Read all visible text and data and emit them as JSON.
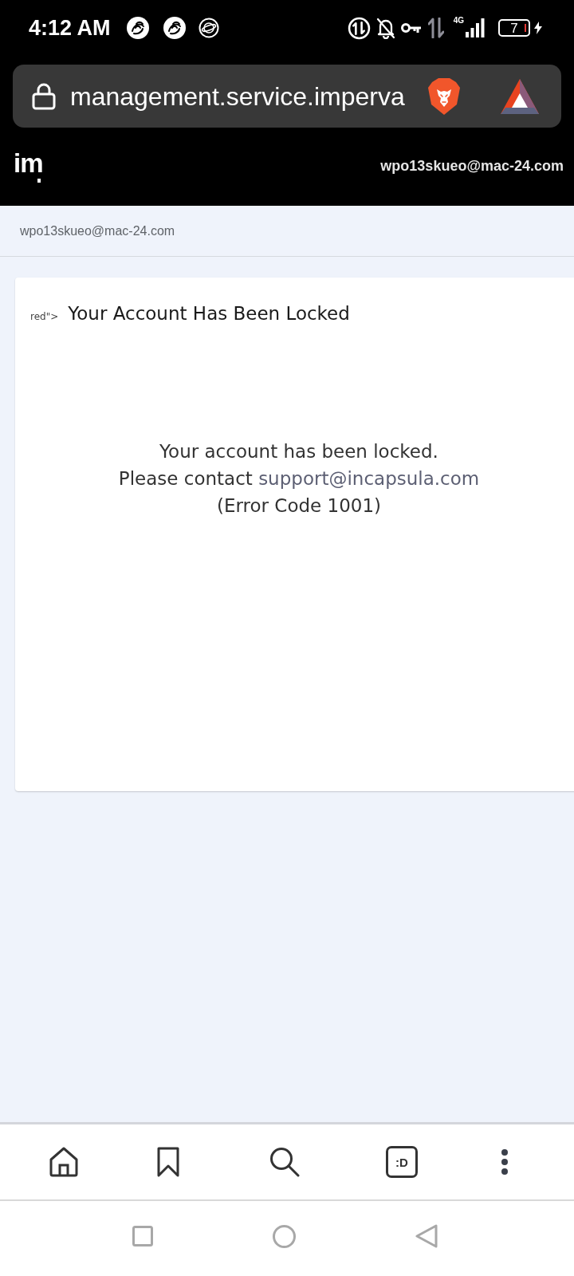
{
  "status_bar": {
    "time": "4:12 AM",
    "network_type": "4G",
    "battery": "7"
  },
  "browser": {
    "url": "management.service.imperva"
  },
  "site_header": {
    "logo": "im",
    "account_email": "wpo13skueo@mac-24.com"
  },
  "breadcrumb": {
    "account": "wpo13skueo@mac-24.com"
  },
  "card": {
    "title_prefix": "red\">",
    "title": "Your Account Has Been Locked",
    "message": {
      "line_1": "Your account has been locked.",
      "contact_prefix": "Please contact",
      "contact_email": "support@incapsula.com",
      "error_code": "(Error Code 1001)"
    }
  },
  "toolbar": {
    "tab_switcher_label": ":D"
  }
}
